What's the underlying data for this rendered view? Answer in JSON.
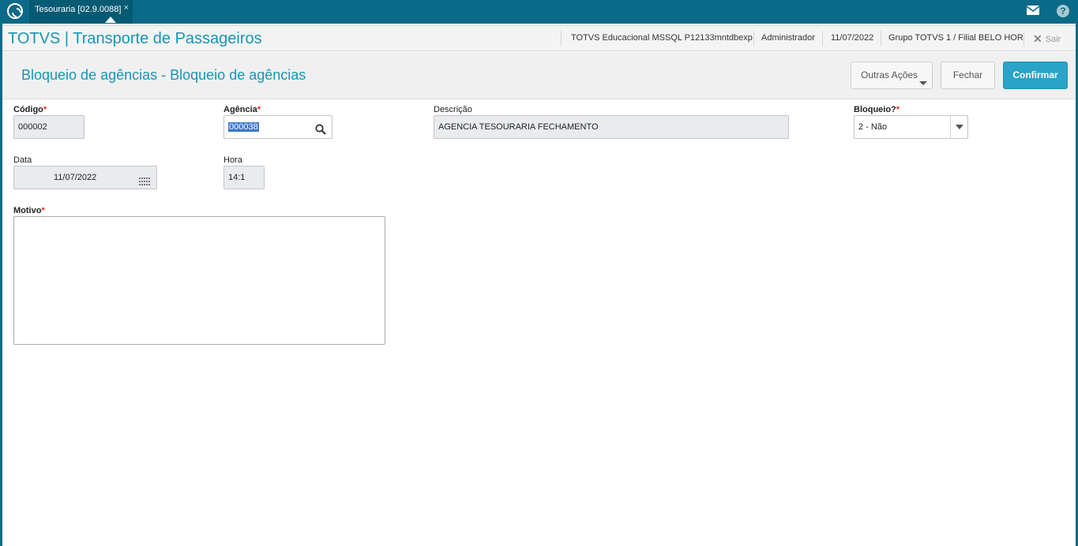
{
  "topbar": {
    "tab_label": "Tesouraria [02.9.0088]",
    "tab_close": "×",
    "help": "?"
  },
  "header": {
    "app_title": "TOTVS | Transporte de Passageiros",
    "environment": "TOTVS Educacional MSSQL P12133mntdbexp",
    "user": "Administrador",
    "date": "11/07/2022",
    "branch": "Grupo TOTVS 1 / Filial BELO HOR",
    "logout_label": "Sair"
  },
  "page": {
    "title": "Bloqueio de agências - Bloqueio de agências",
    "buttons": {
      "outras_acoes": "Outras Ações",
      "fechar": "Fechar",
      "confirmar": "Confirmar"
    }
  },
  "form": {
    "codigo": {
      "label": "Código",
      "required_mark": "*",
      "value": "000002"
    },
    "agencia": {
      "label": "Agência",
      "required_mark": "*",
      "value": "000038"
    },
    "descricao": {
      "label": "Descrição",
      "value": "AGENCIA TESOURARIA FECHAMENTO"
    },
    "bloqueio": {
      "label": "Bloqueio?",
      "required_mark": "*",
      "value": "2 - Não"
    },
    "data": {
      "label": "Data",
      "value": "11/07/2022"
    },
    "hora": {
      "label": "Hora",
      "value": "14:1"
    },
    "motivo": {
      "label": "Motivo",
      "required_mark": "*",
      "value": ""
    }
  },
  "colors": {
    "topbar": "#0b6a87",
    "accent": "#1795b6",
    "confirm_button": "#29a3c6",
    "required": "#e0301e"
  }
}
